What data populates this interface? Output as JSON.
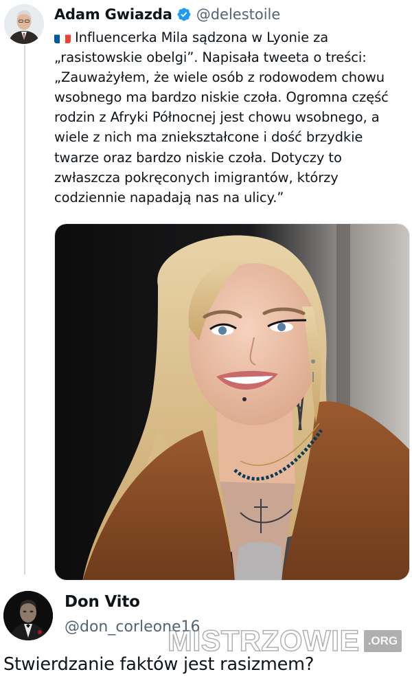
{
  "tweet": {
    "author": {
      "display_name": "Adam Gwiazda",
      "handle": "@delestoile",
      "verified": true,
      "verified_color": "#1d9bf0"
    },
    "flag_icon": "france-flag-icon",
    "lines": [
      "Influencerka Mila sądzona w Lyonie za",
      "„rasistowskie obelgi”. Napisała tweeta o treści:",
      "„Zauważyłem, że wiele osób z rodowodem chowu",
      "wsobnego ma bardzo niskie czoła. Ogromna część",
      "rodzin z Afryki Północnej jest chowu wsobnego, a",
      "wiele z nich ma zniekształcone i dość brzydkie",
      "twarze oraz bardzo niskie czoła. Dotyczy to",
      "zwłaszcza pokręconych imigrantów, którzy",
      "codziennie napadają nas na ulicy.”"
    ],
    "media_icon": "photo-of-woman-in-fur-coat"
  },
  "reply": {
    "author": {
      "display_name": "Don Vito",
      "handle": "@don_corleone16"
    },
    "text": "Stwierdzanie faktów jest rasizmem?"
  },
  "watermark": {
    "text": "MISTRZOWIE",
    "badge": ".ORG"
  }
}
